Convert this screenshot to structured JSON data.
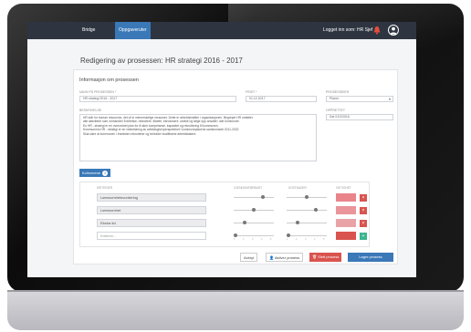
{
  "nav": {
    "brand": "Bridge",
    "active_tab": "Oppgaveruter",
    "user_text": "Logget inn som: HR Sjef"
  },
  "page": {
    "title": "Redigering av prosessen: HR strategi 2016 - 2017"
  },
  "info": {
    "section_title": "Informasjon om prosessen",
    "name_label": "Navn på prosessen *",
    "name_value": "HR strategi 2016 - 2017",
    "frist_label": "Frist *",
    "frist_value": "01.12.2017",
    "owner_label": "Prosesseier",
    "owner_value": "Planer",
    "beskrivelse_label": "Beskrivelse",
    "beskrivelse_lines": [
      "HR står for human resources, det vil si menneskelige ressurser. Dette er arbeidskraften i organisasjonen. Begrepet HR omfatter",
      "alle aktiviteter som omhandler å tiltrekke, rekruttere, tilsette, introdusere, utvikle og følge opp ansatte i alle kommuner.",
      "En HR - strategi er en overordnet plan for å sikre kompetanse, kapasitet og rekruttering til kommunen.",
      "Kommunens HR - strategi er en videreføring av arbeidsgiverperspektivet i kommuneplanens samfunnsdel 2011-2022.",
      "Skal sikre at kommunen i framtiden rekrutterer og beholder kvalifiserte arbeidstakere."
    ],
    "opprettet_label": "Opprettet",
    "opprettet_value": "Sat 01/2/2016"
  },
  "kollonne": {
    "label": "Kollonnene",
    "count": "3"
  },
  "criteria": {
    "headers": {
      "kriterier": "Kriterier",
      "gjennomfoerbart": "Gjennomførbart",
      "kostnader": "Kostnader",
      "viktighet": "Viktighet"
    },
    "rows": [
      {
        "name": "Lønnsomhetsvurdering",
        "g": 3,
        "k": 2
      },
      {
        "name": "Lønnsomhet",
        "g": 2,
        "k": 3
      },
      {
        "name": "Ekstra tid",
        "g": 1,
        "k": 1
      },
      {
        "name": "Kriterier...",
        "g": 0,
        "k": 0
      }
    ],
    "ticks": [
      "1",
      "2",
      "3",
      "4",
      "5"
    ]
  },
  "footer": {
    "avbryt": "Avbryt",
    "aktiver": "Aktiver prosess",
    "slett": "Slett prosess",
    "lagre": "Lagre prosess"
  },
  "colors": {
    "accent": "#3a78b8",
    "danger": "#d9534f",
    "success": "#3bb58f",
    "nav_bg": "#2e3540"
  }
}
